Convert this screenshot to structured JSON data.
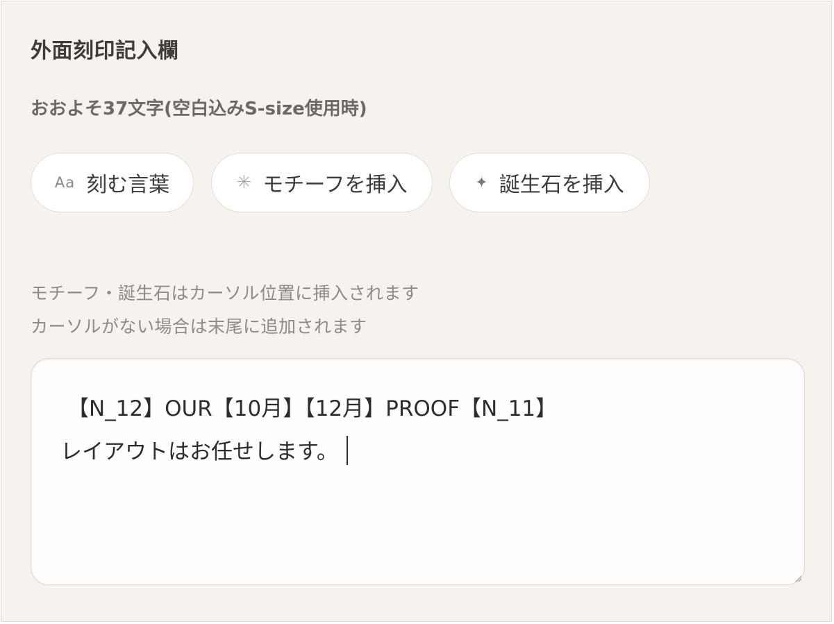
{
  "panel": {
    "title": "外面刻印記入欄",
    "subtitle": "おおよそ37文字(空白込みS-size使用時)"
  },
  "buttons": {
    "words": {
      "icon_text": "Aa",
      "icon": "text-icon",
      "label": "刻む言葉"
    },
    "motif": {
      "icon_text": "✳",
      "icon": "asterisk-icon",
      "label": "モチーフを挿入"
    },
    "stone": {
      "icon_text": "✦",
      "icon": "diamond-sparkle-icon",
      "label": "誕生石を挿入"
    }
  },
  "hints": {
    "line1": "モチーフ・誕生石はカーソル位置に挿入されます",
    "line2": "カーソルがない場合は末尾に追加されます"
  },
  "engraving_input": {
    "line1": "【N_12】OUR【10月】【12月】PROOF【N_11】",
    "line2": "レイアウトはお任せします。"
  }
}
